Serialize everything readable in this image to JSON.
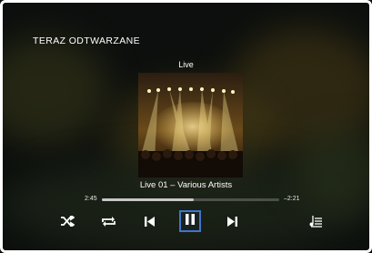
{
  "header": {
    "title": "TERAZ ODTWARZANE"
  },
  "album": {
    "name": "Live",
    "art_icon": "concert-stage-art"
  },
  "track": {
    "title": "Live 01 – Various Artists"
  },
  "progress": {
    "elapsed": "2:45",
    "remaining": "–2:21",
    "fraction": 0.52
  },
  "controls": {
    "shuffle_icon": "shuffle-icon",
    "repeat_icon": "repeat-icon",
    "previous_icon": "skip-previous-icon",
    "pause_icon": "pause-icon",
    "next_icon": "skip-next-icon",
    "queue_icon": "playlist-icon"
  },
  "colors": {
    "focus": "#3f76c8",
    "background": "#0c0f0d",
    "text": "#ffffff"
  }
}
